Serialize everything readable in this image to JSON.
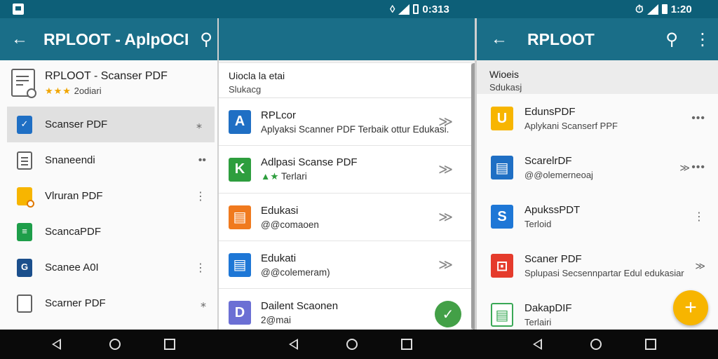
{
  "status": {
    "left_time": "0:313",
    "right_time": "1:20"
  },
  "panel1": {
    "title": "RPLOOT - AplpOCI",
    "head": {
      "name": "RPLOOT - Scanser PDF",
      "stars": "★★★",
      "sub": "2odiari"
    },
    "items": [
      {
        "label": "Scanser PDF",
        "icon": "pdf-blue-icon",
        "selected": true,
        "more": "⁎"
      },
      {
        "label": "Snaneendi",
        "icon": "doc-lines-icon",
        "more": "••"
      },
      {
        "label": "Vlruran PDF",
        "icon": "orange-file-icon",
        "more": "⋮"
      },
      {
        "label": "ScancaPDF",
        "icon": "green-sheet-icon",
        "more": ""
      },
      {
        "label": "Scanee A0I",
        "icon": "navy-file-icon",
        "more": "⋮"
      },
      {
        "label": "Scarner PDF",
        "icon": "blank-doc-icon",
        "more": "⁎"
      }
    ]
  },
  "panel2": {
    "head": {
      "line1": "Uiocla la etai",
      "line2": "Slukacg"
    },
    "items": [
      {
        "title": "RPLcor",
        "sub": "Aplyaksi Scanner PDF Terbaik ottur Edukasi.",
        "tile": "A",
        "color": "#1f6fc4"
      },
      {
        "title": "Adlpasi Scanse PDF",
        "sub": "Terlari",
        "tile": "K",
        "color": "#2e9e3e",
        "stars": true
      },
      {
        "title": "Edukasi",
        "sub": "@@comaoen",
        "tile": "▤",
        "color": "#f07a1e"
      },
      {
        "title": "Edukati",
        "sub": "@@colemeram)",
        "tile": "▤",
        "color": "#1e77d6"
      },
      {
        "title": "Dailent Scaonen",
        "sub": "2@mai",
        "tile": "D",
        "color": "#6b6fd4"
      }
    ],
    "chevron": "≫",
    "check": "✓"
  },
  "panel3": {
    "title": "RPLOOT",
    "head": {
      "line1": "Wioeis",
      "line2": "Sdukasj"
    },
    "items": [
      {
        "title": "EdunsPDF",
        "sub": "Aplykani Scanserf PPF",
        "color": "#f7b500",
        "tile": "U",
        "more": "•••"
      },
      {
        "title": "ScarelrDF",
        "sub": "@@olemerneoaj",
        "color": "#1f6fc4",
        "tile": "▤",
        "chev": "≫",
        "more": "•••"
      },
      {
        "title": "ApukssPDT",
        "sub": "Terloid",
        "color": "#1e77d6",
        "tile": "S",
        "more": "⋮"
      },
      {
        "title": "Scaner PDF",
        "sub": "Splupasi Secsennpartar Edul edukasiar",
        "color": "#e53b2c",
        "tile": "⊡",
        "chev": "≫"
      },
      {
        "title": "DakapDIF",
        "sub": "Terlairi",
        "color": "#ffffff",
        "tile": "▤"
      }
    ],
    "fab": "+"
  }
}
